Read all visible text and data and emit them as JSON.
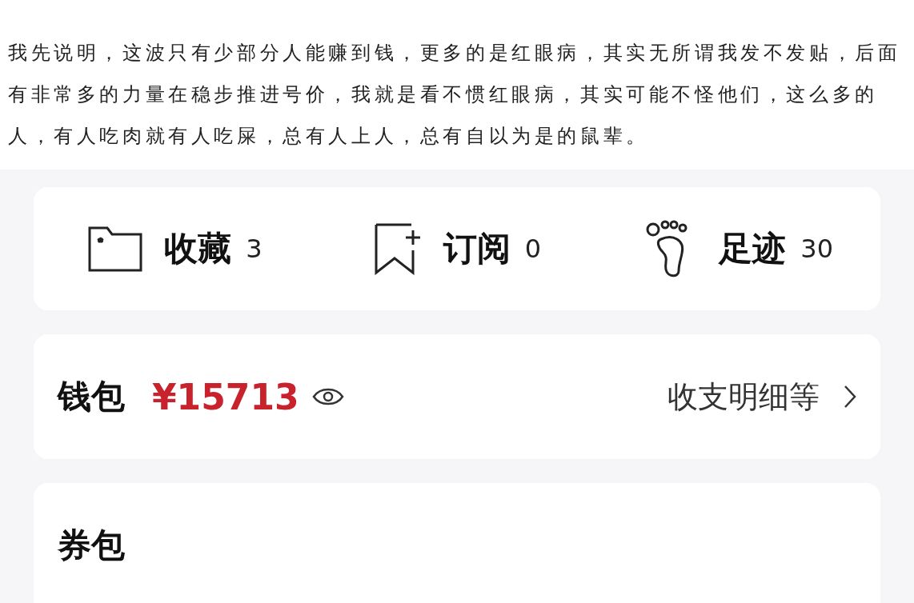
{
  "post": {
    "text": "我先说明，这波只有少部分人能赚到钱，更多的是红眼病，其实无所谓我发不发贴，后面有非常多的力量在稳步推进号价，我就是看不惯红眼病，其实可能不怪他们，这么多的人，有人吃肉就有人吃屎，总有人上人，总有自以为是的鼠辈。"
  },
  "shortcuts": [
    {
      "kind": "folder",
      "label": "收藏",
      "count": "3"
    },
    {
      "kind": "bookmark",
      "label": "订阅",
      "count": "0"
    },
    {
      "kind": "footprint",
      "label": "足迹",
      "count": "30"
    }
  ],
  "wallet": {
    "label": "钱包",
    "amount": "¥15713",
    "link": "收支明细等"
  },
  "coupons": {
    "label": "券包"
  }
}
